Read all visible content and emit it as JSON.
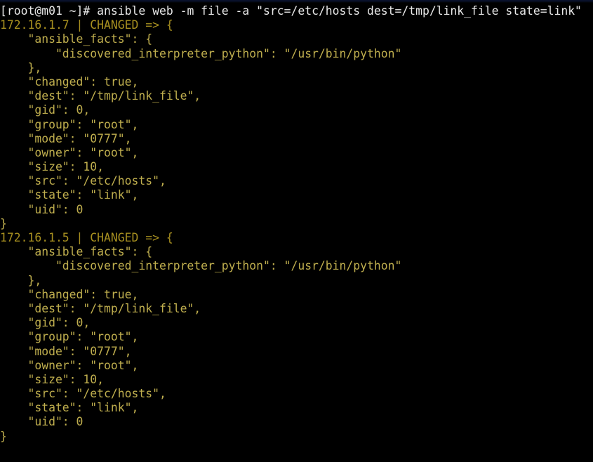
{
  "terminal": {
    "title": "root@m01:~",
    "background_color": "#000000",
    "prompt_color": "#e8e8e8",
    "output_color": "#bfae4e",
    "host_header_color": "#a89020",
    "columns": 84,
    "rows": 32
  },
  "prompt": {
    "text": "[root@m01 ~]#",
    "user": "root",
    "host": "m01",
    "cwd": "~",
    "symbol": "#"
  },
  "command": {
    "full": " ansible web -m file -a \"src=/etc/hosts dest=/tmp/link_file state=link\"",
    "program": "ansible",
    "pattern": "web",
    "module": "file",
    "args": "src=/etc/hosts dest=/tmp/link_file state=link"
  },
  "output": {
    "lines": [
      "172.16.1.7 | CHANGED => {",
      "    \"ansible_facts\": {",
      "        \"discovered_interpreter_python\": \"/usr/bin/python\"",
      "    },",
      "    \"changed\": true,",
      "    \"dest\": \"/tmp/link_file\",",
      "    \"gid\": 0,",
      "    \"group\": \"root\",",
      "    \"mode\": \"0777\",",
      "    \"owner\": \"root\",",
      "    \"size\": 10,",
      "    \"src\": \"/etc/hosts\",",
      "    \"state\": \"link\",",
      "    \"uid\": 0",
      "}",
      "172.16.1.5 | CHANGED => {",
      "    \"ansible_facts\": {",
      "        \"discovered_interpreter_python\": \"/usr/bin/python\"",
      "    },",
      "    \"changed\": true,",
      "    \"dest\": \"/tmp/link_file\",",
      "    \"gid\": 0,",
      "    \"group\": \"root\",",
      "    \"mode\": \"0777\",",
      "    \"owner\": \"root\",",
      "    \"size\": 10,",
      "    \"src\": \"/etc/hosts\",",
      "    \"state\": \"link\",",
      "    \"uid\": 0",
      "}"
    ],
    "line_kinds": [
      "host",
      "json",
      "json",
      "json",
      "json",
      "json",
      "json",
      "json",
      "json",
      "json",
      "json",
      "json",
      "json",
      "json",
      "brace",
      "host",
      "json",
      "json",
      "json",
      "json",
      "json",
      "json",
      "json",
      "json",
      "json",
      "json",
      "json",
      "json",
      "json",
      "brace"
    ],
    "hosts": [
      {
        "ip": "172.16.1.7",
        "status": "CHANGED",
        "result": {
          "ansible_facts": {
            "discovered_interpreter_python": "/usr/bin/python"
          },
          "changed": "true",
          "dest": "/tmp/link_file",
          "gid": "0",
          "group": "root",
          "mode": "0777",
          "owner": "root",
          "size": "10",
          "src": "/etc/hosts",
          "state": "link",
          "uid": "0"
        }
      },
      {
        "ip": "172.16.1.5",
        "status": "CHANGED",
        "result": {
          "ansible_facts": {
            "discovered_interpreter_python": "/usr/bin/python"
          },
          "changed": "true",
          "dest": "/tmp/link_file",
          "gid": "0",
          "group": "root",
          "mode": "0777",
          "owner": "root",
          "size": "10",
          "src": "/etc/hosts",
          "state": "link",
          "uid": "0"
        }
      }
    ]
  }
}
